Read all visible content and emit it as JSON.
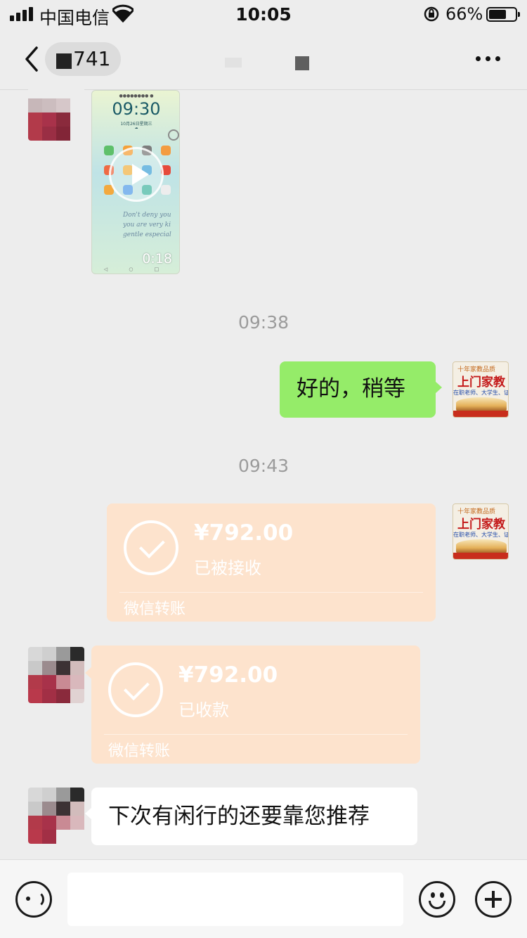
{
  "status_bar": {
    "carrier": "中国电信",
    "time": "10:05",
    "battery_percent": "66%",
    "battery_level": 0.66,
    "icons": [
      "signal-icon",
      "wifi-icon",
      "rotation-lock-icon",
      "battery-icon"
    ]
  },
  "nav": {
    "title_partial": "741",
    "back_icon": "chevron-left-icon",
    "more_icon": "more-dots-icon"
  },
  "video_message": {
    "duration": "0:18",
    "phone_clock": "09:30",
    "phone_date": "10月26日星期三"
  },
  "messages": [
    {
      "type": "timestamp",
      "text": "09:38"
    },
    {
      "type": "text",
      "side": "right",
      "text": "好的，稍等"
    },
    {
      "type": "timestamp",
      "text": "09:43"
    },
    {
      "type": "transfer",
      "side": "right",
      "amount": "¥792.00",
      "state": "已被接收",
      "label": "微信转账"
    },
    {
      "type": "transfer",
      "side": "left",
      "amount": "¥792.00",
      "state": "已收款",
      "label": "微信转账"
    },
    {
      "type": "text",
      "side": "left",
      "text": "下次有闲行的还要靠您推荐"
    }
  ],
  "my_avatar": {
    "top_text": "十年家教品质",
    "main_text": "上门家教",
    "sub_text": "在职老师、大学生、证件齐全"
  },
  "input_bar": {
    "value": "",
    "icons": [
      "voice-icon",
      "emoji-icon",
      "plus-icon"
    ]
  },
  "colors": {
    "background": "#ededed",
    "sent_bubble": "#95ec69",
    "received_bubble": "#ffffff",
    "transfer_received": "#fde3cd",
    "timestamp_text": "#9b9b9b"
  }
}
